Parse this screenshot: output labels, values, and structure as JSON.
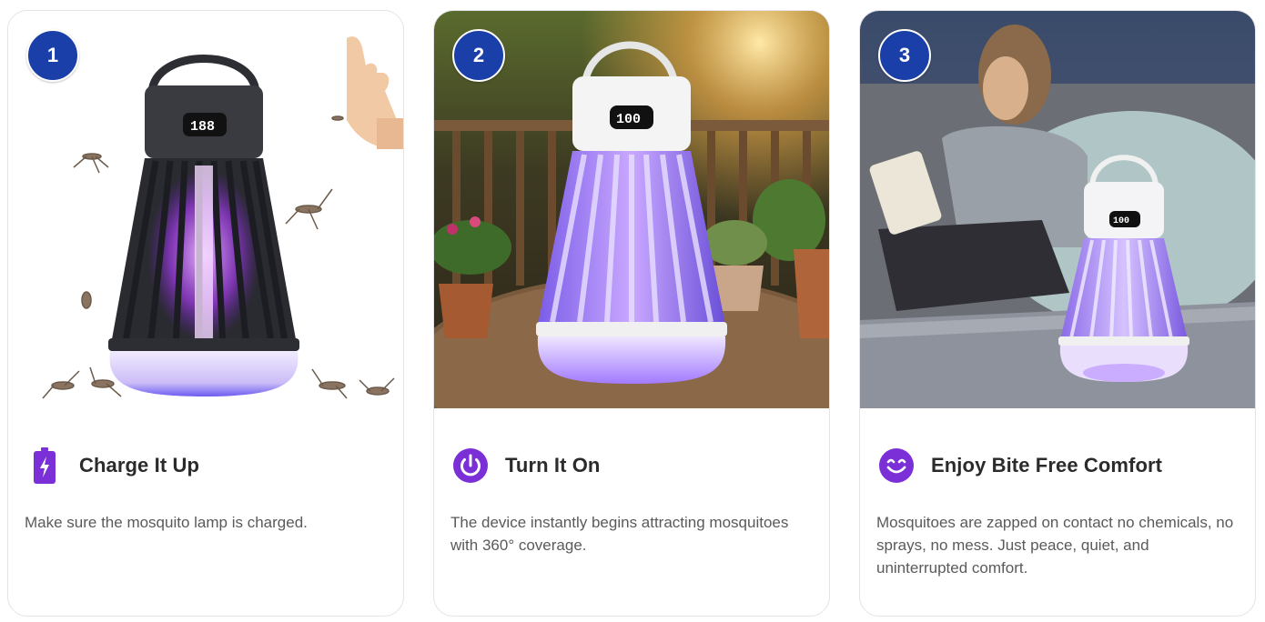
{
  "steps": [
    {
      "number": "1",
      "title": "Charge It Up",
      "description": "Make sure the mosquito lamp is charged.",
      "icon": "battery-charging-icon",
      "display_text": "188"
    },
    {
      "number": "2",
      "title": "Turn It On",
      "description": "The device instantly begins attracting mosquitoes with 360° coverage.",
      "icon": "power-icon",
      "display_text": "100"
    },
    {
      "number": "3",
      "title": "Enjoy Bite Free Comfort",
      "description": "Mosquitoes are zapped on contact no chemicals, no sprays, no mess. Just peace, quiet, and uninterrupted comfort.",
      "icon": "smile-icon",
      "display_text": "100"
    }
  ],
  "colors": {
    "badge": "#1b3fa8",
    "icon_purple": "#7b2fd6",
    "title_text": "#2b2b2b",
    "body_text": "#5a5a5a"
  }
}
